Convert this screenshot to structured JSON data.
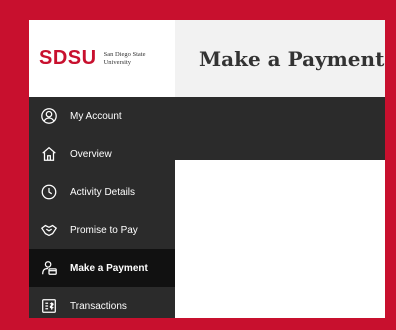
{
  "brand": {
    "logo_text": "SDSU",
    "logo_subtext": "San Diego State University"
  },
  "page": {
    "title": "Make a Payment"
  },
  "sidebar": {
    "items": [
      {
        "label": "My Account",
        "icon": "user-circle-icon",
        "active": false
      },
      {
        "label": "Overview",
        "icon": "home-icon",
        "active": false
      },
      {
        "label": "Activity Details",
        "icon": "clock-icon",
        "active": false
      },
      {
        "label": "Promise to Pay",
        "icon": "handshake-icon",
        "active": false
      },
      {
        "label": "Make a Payment",
        "icon": "payment-icon",
        "active": true
      },
      {
        "label": "Transactions",
        "icon": "receipt-icon",
        "active": false
      }
    ]
  },
  "colors": {
    "brand_red": "#c8102e",
    "sidebar_bg": "#2b2b2b",
    "active_bg": "#111111"
  }
}
